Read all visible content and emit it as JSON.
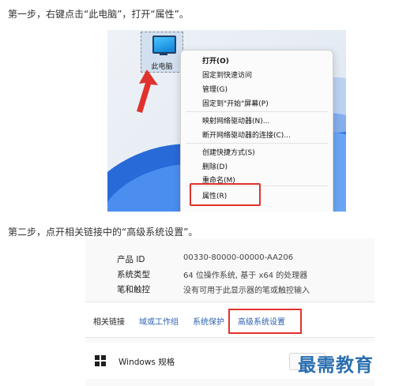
{
  "steps": {
    "step1": "第一步，右键点击“此电脑”，打开“属性”。",
    "step2": "第二步，点开相关链接中的“高级系统设置”。"
  },
  "shot1": {
    "desktop_icon_label": "此电脑",
    "menu_items": [
      "打开(O)",
      "固定到快速访问",
      "管理(G)",
      "固定到\"开始\"屏幕(P)",
      "映射网络驱动器(N)...",
      "断开网络驱动器的连接(C)...",
      "创建快捷方式(S)",
      "删除(D)",
      "重命名(M)",
      "属性(R)"
    ],
    "highlight_color": "#e0322d"
  },
  "shot2": {
    "specs": [
      {
        "label": "产品 ID",
        "value": "00330-80000-00000-AA206"
      },
      {
        "label": "系统类型",
        "value": "64 位操作系统, 基于 x64 的处理器"
      },
      {
        "label": "笔和触控",
        "value": "没有可用于此显示器的笔或触控输入"
      }
    ],
    "related_links_label": "相关链接",
    "related_links": [
      "域或工作组",
      "系统保护",
      "高级系统设置"
    ],
    "windows_spec_title": "Windows 规格",
    "link_color": "#2a5fb0"
  },
  "watermark": "最需教育"
}
